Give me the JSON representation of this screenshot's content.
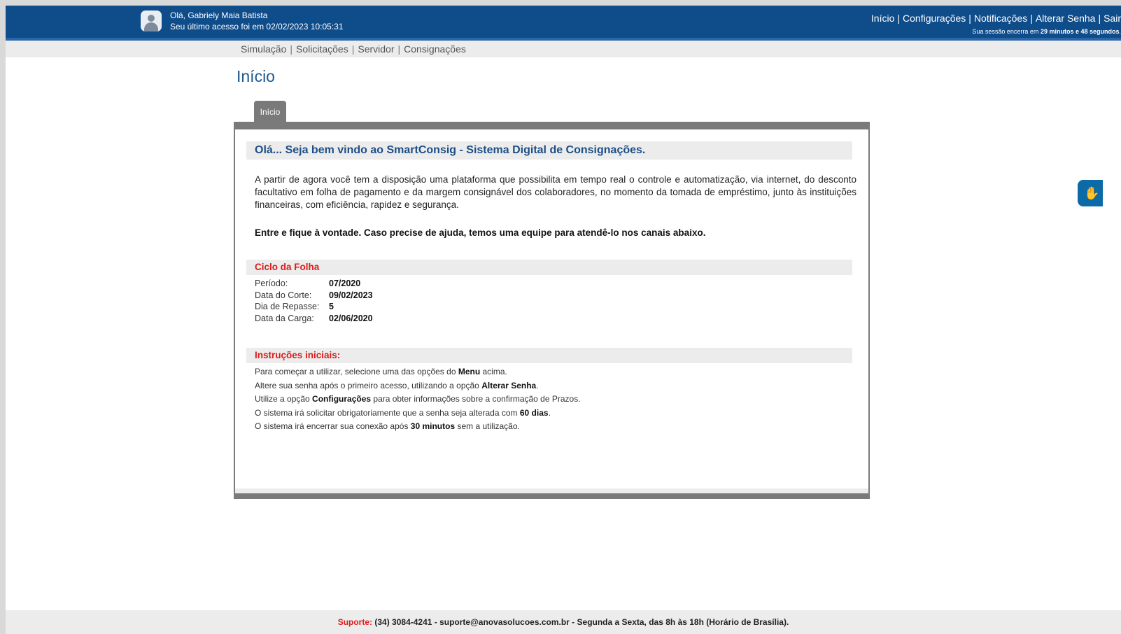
{
  "header": {
    "greeting": "Olá, Gabriely Maia Batista",
    "last_access": "Seu último acesso foi em 02/02/2023 10:05:31",
    "nav": [
      "Início",
      "Configurações",
      "Notificações",
      "Alterar Senha",
      "Sair"
    ],
    "session_prefix": "Sua sessão encerra em",
    "session_remaining": "29 minutos e 48 segundos",
    "session_suffix": "."
  },
  "subnav": {
    "items": [
      "Simulação",
      "Solicitações",
      "Servidor",
      "Consignações"
    ]
  },
  "page_title": "Início",
  "tab_label": "Início",
  "welcome": {
    "title": "Olá... Seja bem vindo ao SmartConsig - Sistema Digital de Consignações.",
    "intro": "A partir de agora você tem a disposição uma plataforma que possibilita em tempo real o controle e automatização, via internet, do desconto facultativo em folha de pagamento e da margem consignável dos colaboradores, no momento da tomada de empréstimo, junto às instituições financeiras, com eficiência, rapidez e segurança.",
    "cta": "Entre e fique à vontade. Caso precise de ajuda, temos uma equipe para atendê-lo nos canais abaixo."
  },
  "cycle": {
    "title": "Ciclo da Folha",
    "rows": [
      {
        "label": "Período:",
        "value": "07/2020"
      },
      {
        "label": "Data do Corte:",
        "value": "09/02/2023"
      },
      {
        "label": "Dia de Repasse:",
        "value": "5"
      },
      {
        "label": "Data da Carga:",
        "value": "02/06/2020"
      }
    ]
  },
  "instructions": {
    "title": "Instruções iniciais:",
    "lines": [
      {
        "before": "Para começar a utilizar, selecione uma das opções do ",
        "bold": "Menu",
        "after": " acima."
      },
      {
        "before": "Altere sua senha após o primeiro acesso, utilizando a opção ",
        "bold": "Alterar Senha",
        "after": "."
      },
      {
        "before": "Utilize a opção ",
        "bold": "Configurações",
        "after": " para obter informações sobre a confirmação de Prazos."
      },
      {
        "before": "O sistema irá solicitar obrigatoriamente que a senha seja alterada com ",
        "bold": "60 dias",
        "after": "."
      },
      {
        "before": "O sistema irá encerrar sua conexão após ",
        "bold": "30 minutos",
        "after": " sem a utilização."
      }
    ]
  },
  "footer": {
    "label": "Suporte:",
    "text": "(34) 3084-4241 - suporte@anovasolucoes.com.br - Segunda a Sexta, das 8h às 18h (Horário de Brasília)."
  },
  "icons": {
    "avatar": "user-avatar-icon",
    "accessibility": "vlibras-hands-icon"
  },
  "colors": {
    "header": "#0f4c8a",
    "accent_red": "#e01a1a",
    "title_blue": "#1d4f86"
  }
}
